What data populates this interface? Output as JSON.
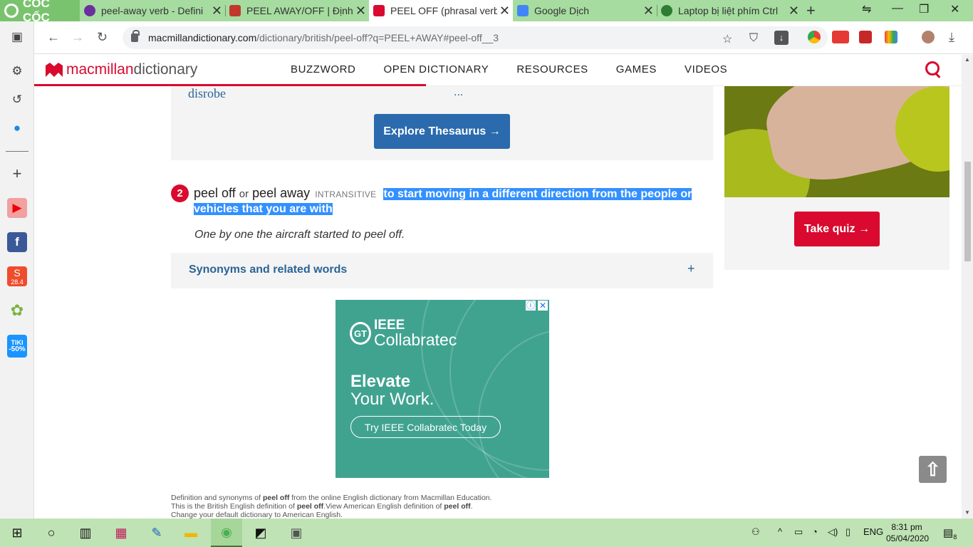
{
  "browser": {
    "brand": "CỐC CỐC",
    "tabs": [
      {
        "title": "peel-away verb - Defini"
      },
      {
        "title": "PEEL AWAY/OFF | Định n"
      },
      {
        "title": "PEEL OFF (phrasal verb)"
      },
      {
        "title": "Google Dịch"
      },
      {
        "title": "Laptop bị liệt phím Ctrl"
      }
    ],
    "url_host": "macmillandictionary.com",
    "url_path": "/dictionary/british/peel-off?q=PEEL+AWAY#peel-off__3"
  },
  "sidebar": {
    "shopee_badge": "28.4",
    "tiki_label": "TIKI",
    "tiki_discount": "-50%"
  },
  "site": {
    "brand_1": "macmillan",
    "brand_2": "dictionary",
    "nav": [
      "BUZZWORD",
      "OPEN DICTIONARY",
      "RESOURCES",
      "GAMES",
      "VIDEOS"
    ]
  },
  "thesaurus": {
    "word": "disrobe",
    "more": "...",
    "button": "Explore Thesaurus →"
  },
  "sense": {
    "number": "2",
    "head1": "peel off",
    "or": "or",
    "head2": "peel away",
    "grammar": "INTRANSITIVE",
    "definition": "to start moving in a different direction from the people or vehicles that you are with",
    "example": "One by one the aircraft started to peel off."
  },
  "synonyms": {
    "label": "Synonyms and related words",
    "toggle": "+"
  },
  "ad": {
    "logo_top": "IEEE",
    "logo_bottom": "Collabratec",
    "headline1": "Elevate",
    "headline2": "Your Work.",
    "cta": "Try IEEE Collabratec Today"
  },
  "footer": {
    "line1_a": "Definition and synonyms of ",
    "line1_b": "peel off",
    "line1_c": " from the online English dictionary from Macmillan Education.",
    "line2_a": "This is the British English definition of ",
    "line2_b": "peel off",
    "line2_c": ".View American English definition of ",
    "line2_d": "peel off",
    "line2_e": ".",
    "line3": "Change your default dictionary to American English."
  },
  "quiz": {
    "button": "Take quiz →"
  },
  "taskbar": {
    "lang": "ENG",
    "time": "8:31 pm",
    "date": "05/04/2020",
    "notifications": "8"
  },
  "colors": {
    "brand_red": "#d9092f",
    "link_blue": "#2a6496",
    "button_blue": "#2a6aad",
    "selection": "#3390ff"
  }
}
